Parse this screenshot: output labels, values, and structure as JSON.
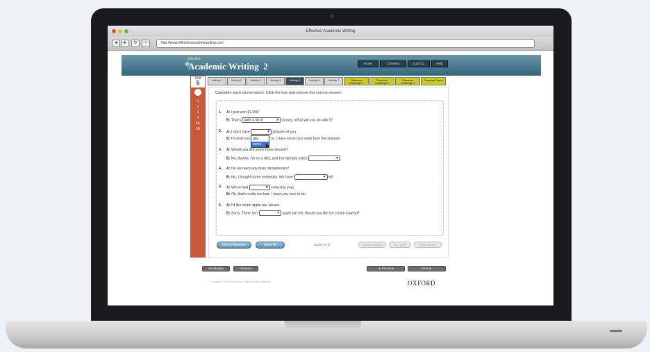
{
  "browser": {
    "title": "Effective Academic Writing",
    "url": "http://www.effectiveacademicwriting.com"
  },
  "header": {
    "tagline": "effective",
    "logo": "Academic Writing",
    "level": "2",
    "buttons": [
      "Home",
      "Contents",
      "Log Out",
      "Help"
    ]
  },
  "sidebar": {
    "unit_label": "Unit",
    "unit_number": "5",
    "items": [
      "1",
      "2",
      "3",
      "4",
      "5A",
      "5B"
    ]
  },
  "tabs": [
    {
      "label": "Activity 1",
      "state": "normal"
    },
    {
      "label": "Activity 2",
      "state": "normal"
    },
    {
      "label": "Activity 3",
      "state": "normal"
    },
    {
      "label": "Activity 4",
      "state": "normal"
    },
    {
      "label": "Activity 5",
      "state": "active"
    },
    {
      "label": "Activity 6",
      "state": "normal"
    },
    {
      "label": "Activity 7",
      "state": "normal"
    },
    {
      "label": "Grammar Challenge 1",
      "state": "yellow"
    },
    {
      "label": "Grammar Challenge 2",
      "state": "yellow"
    },
    {
      "label": "Grammar Challenge 3",
      "state": "yellow"
    },
    {
      "label": "Grammar Game",
      "state": "yellow"
    }
  ],
  "instructions": "Complete each conversation. Click the box and choose the correct answer.",
  "questions": [
    {
      "num": "1.",
      "a": "I just won $1,000!",
      "b_pre": "That's",
      "b_sel": "quite a lot of",
      "b_post": "money. What will you do with it?"
    },
    {
      "num": "2.",
      "a_pre": "I don't have",
      "a_sel": "",
      "a_post": "pictures of you.",
      "b_pre": "I'll send you",
      "b_post": "nt. I have some nice ones from the summer."
    },
    {
      "num": "3.",
      "a": "Would you like some more dessert?",
      "b_pre": "No, thanks. I'm on a diet, and I've already eaten",
      "b_sel": ""
    },
    {
      "num": "4.",
      "a": "Do we need any more strawberries?",
      "b_pre": "No, I bought some yesterday. We have",
      "b_sel": "",
      "b_post": "left."
    },
    {
      "num": "5.",
      "a_pre": "We've had",
      "a_sel": "",
      "a_post": "snow this year.",
      "b": "Oh, that's really too bad. I know you love to ski."
    },
    {
      "num": "6.",
      "a": "I'd like some apple pie, please.",
      "b_pre": "Sorry. There isn't",
      "b_sel": "",
      "b_post": "apple pie left. Would you like ice cream instead?"
    }
  ],
  "speaker_a": "A:",
  "speaker_b": "B:",
  "dropdown_options": [
    "any",
    "some"
  ],
  "actions": {
    "check_answers": "Check Answers",
    "clear_all": "Clear All",
    "score": "Score: 0 / 6",
    "show_answers": "Show Answers",
    "try_again": "Try Again",
    "print_results": "Print Results"
  },
  "footer": {
    "vocabulary": "Vocabulary",
    "glossary": "Glossary",
    "previous": "◄ Previous",
    "next": "Next ►",
    "copyright": "Copyright © Oxford University Press. All rights reserved.",
    "brand": "OXFORD"
  }
}
